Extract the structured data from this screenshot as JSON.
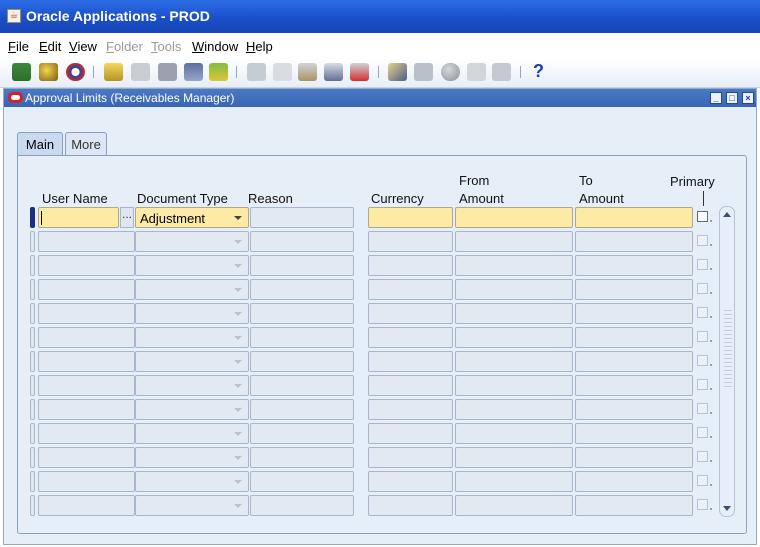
{
  "window": {
    "title": "Oracle Applications - PROD"
  },
  "menu": [
    {
      "label": "File",
      "enabled": true
    },
    {
      "label": "Edit",
      "enabled": true
    },
    {
      "label": "View",
      "enabled": true
    },
    {
      "label": "Folder",
      "enabled": false
    },
    {
      "label": "Tools",
      "enabled": false
    },
    {
      "label": "Window",
      "enabled": true
    },
    {
      "label": "Help",
      "enabled": true
    }
  ],
  "toolbar": {
    "icons": [
      "new-record-icon",
      "find-icon",
      "navigator-icon",
      "save-icon",
      "switch-responsibility-icon",
      "print-icon",
      "close-form-icon",
      "cut-icon",
      "copy-icon",
      "paste-icon",
      "new-record-alt-icon",
      "delete-record-icon",
      "edit-field-icon",
      "zoom-icon",
      "translations-icon",
      "attachments-icon",
      "folder-tools-icon",
      "help-icon"
    ],
    "help_label": "?"
  },
  "form": {
    "title": "Approval Limits (Receivables Manager)",
    "tabs": [
      {
        "label": "Main",
        "active": true
      },
      {
        "label": "More",
        "active": false
      }
    ],
    "columns": {
      "user_name": "User Name",
      "document_type": "Document Type",
      "reason": "Reason",
      "currency": "Currency",
      "from_amount_1": "From",
      "from_amount_2": "Amount",
      "to_amount_1": "To",
      "to_amount_2": "Amount",
      "primary": "Primary"
    },
    "rows": [
      {
        "user_name": "",
        "document_type": "Adjustment",
        "reason": "",
        "currency": "",
        "from_amount": "",
        "to_amount": "",
        "primary": false,
        "current": true
      },
      {
        "user_name": "",
        "document_type": "",
        "reason": "",
        "currency": "",
        "from_amount": "",
        "to_amount": "",
        "primary": false,
        "current": false
      },
      {
        "user_name": "",
        "document_type": "",
        "reason": "",
        "currency": "",
        "from_amount": "",
        "to_amount": "",
        "primary": false,
        "current": false
      },
      {
        "user_name": "",
        "document_type": "",
        "reason": "",
        "currency": "",
        "from_amount": "",
        "to_amount": "",
        "primary": false,
        "current": false
      },
      {
        "user_name": "",
        "document_type": "",
        "reason": "",
        "currency": "",
        "from_amount": "",
        "to_amount": "",
        "primary": false,
        "current": false
      },
      {
        "user_name": "",
        "document_type": "",
        "reason": "",
        "currency": "",
        "from_amount": "",
        "to_amount": "",
        "primary": false,
        "current": false
      },
      {
        "user_name": "",
        "document_type": "",
        "reason": "",
        "currency": "",
        "from_amount": "",
        "to_amount": "",
        "primary": false,
        "current": false
      },
      {
        "user_name": "",
        "document_type": "",
        "reason": "",
        "currency": "",
        "from_amount": "",
        "to_amount": "",
        "primary": false,
        "current": false
      },
      {
        "user_name": "",
        "document_type": "",
        "reason": "",
        "currency": "",
        "from_amount": "",
        "to_amount": "",
        "primary": false,
        "current": false
      },
      {
        "user_name": "",
        "document_type": "",
        "reason": "",
        "currency": "",
        "from_amount": "",
        "to_amount": "",
        "primary": false,
        "current": false
      },
      {
        "user_name": "",
        "document_type": "",
        "reason": "",
        "currency": "",
        "from_amount": "",
        "to_amount": "",
        "primary": false,
        "current": false
      },
      {
        "user_name": "",
        "document_type": "",
        "reason": "",
        "currency": "",
        "from_amount": "",
        "to_amount": "",
        "primary": false,
        "current": false
      },
      {
        "user_name": "",
        "document_type": "",
        "reason": "",
        "currency": "",
        "from_amount": "",
        "to_amount": "",
        "primary": false,
        "current": false
      }
    ]
  },
  "colors": {
    "title_blue": "#1b4fc9",
    "required_field": "#fdeaa5",
    "panel_bg": "#e6eef8"
  }
}
